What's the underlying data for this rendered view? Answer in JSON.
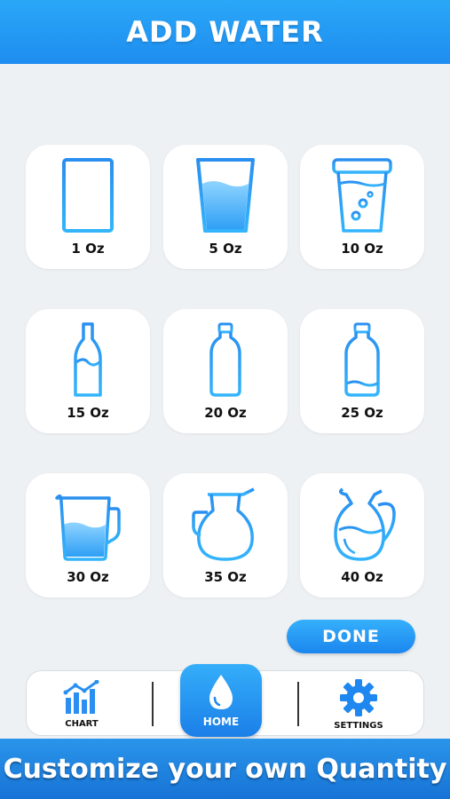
{
  "header": {
    "title": "ADD WATER"
  },
  "options": [
    {
      "label": "1 Oz",
      "icon": "empty-glass-icon"
    },
    {
      "label": "5 Oz",
      "icon": "half-glass-icon"
    },
    {
      "label": "10 Oz",
      "icon": "cup-with-lid-icon"
    },
    {
      "label": "15 Oz",
      "icon": "glass-bottle-icon"
    },
    {
      "label": "20 Oz",
      "icon": "small-plastic-bottle-icon"
    },
    {
      "label": "25 Oz",
      "icon": "large-plastic-bottle-icon"
    },
    {
      "label": "30 Oz",
      "icon": "pitcher-icon"
    },
    {
      "label": "35 Oz",
      "icon": "carafe-icon"
    },
    {
      "label": "40 Oz",
      "icon": "jug-icon"
    }
  ],
  "done_label": "DONE",
  "nav": {
    "chart_label": "CHART",
    "home_label": "HOME",
    "settings_label": "SETTINGS"
  },
  "banner": {
    "text": "Customize your own Quantity"
  },
  "colors": {
    "accent": "#1e8df0",
    "background": "#eef1f4"
  }
}
